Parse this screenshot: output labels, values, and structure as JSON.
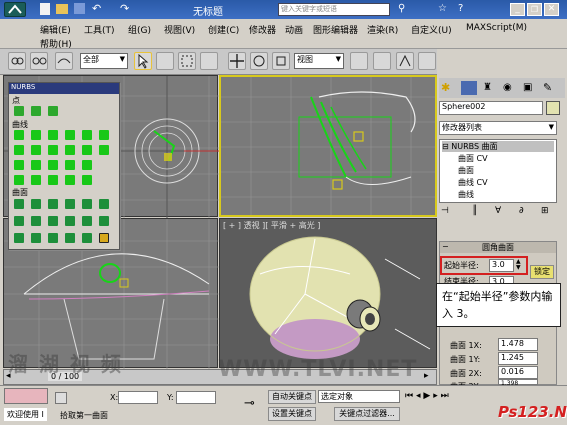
{
  "window": {
    "title": "无标题",
    "search_placeholder": "键入关键字或短语"
  },
  "menu": {
    "row1": [
      "编辑(E)",
      "工具(T)",
      "组(G)",
      "视图(V)",
      "创建(C)",
      "修改器",
      "动画",
      "图形编辑器",
      "渲染(R)",
      "自定义(U)",
      "MAXScript(M)"
    ],
    "row2": [
      "帮助(H)"
    ]
  },
  "toolbar": {
    "selection_filter": "全部",
    "coord_system": "视图"
  },
  "palette": {
    "title": "NURBS",
    "section_point": "点",
    "section_curve": "曲线",
    "section_surface": "曲面"
  },
  "viewports": {
    "perspective_label": "[ + ] 透视 ][ 平滑 + 高光 ]",
    "timeline": "0 / 100"
  },
  "command_panel": {
    "object_name": "Sphere002",
    "modifier_list": "修改器列表",
    "stack": [
      "NURBS 曲面",
      "曲面 CV",
      "曲面",
      "曲线 CV",
      "曲线"
    ],
    "rollout_title": "圆角曲面",
    "start_radius_label": "起始半径:",
    "start_radius_value": "3.0",
    "end_radius_label": "结束半径:",
    "end_radius_value": "3.0",
    "lock_label": "锁定",
    "surface1x_label": "曲面 1X:",
    "surface1x_value": "1.478",
    "surface1y_label": "曲面 1Y:",
    "surface1y_value": "1.245",
    "surface2x_label": "曲面 2X:",
    "surface2x_value": "0.016",
    "surface2y_label": "曲面 2Y:",
    "surface2y_value": "1.398"
  },
  "callout": {
    "text": "在“起始半径”参数内输入 3。"
  },
  "status": {
    "welcome": "欢迎使用 I",
    "prompt": "拾取第一曲面",
    "x_label": "X:",
    "y_label": "Y:",
    "auto_key": "自动关键点",
    "selected_object": "选定对象",
    "set_key": "设置关键点",
    "key_filter": "关键点过滤器..."
  },
  "watermark": {
    "left": "溜 湖 视 频",
    "right": "WWW.TLVI.NET",
    "logo": "Ps123.Net"
  },
  "colors": {
    "title": "#2a5aa8",
    "highlight": "#d7c91c",
    "callout_border": "#d42020",
    "green": "#18d418"
  }
}
